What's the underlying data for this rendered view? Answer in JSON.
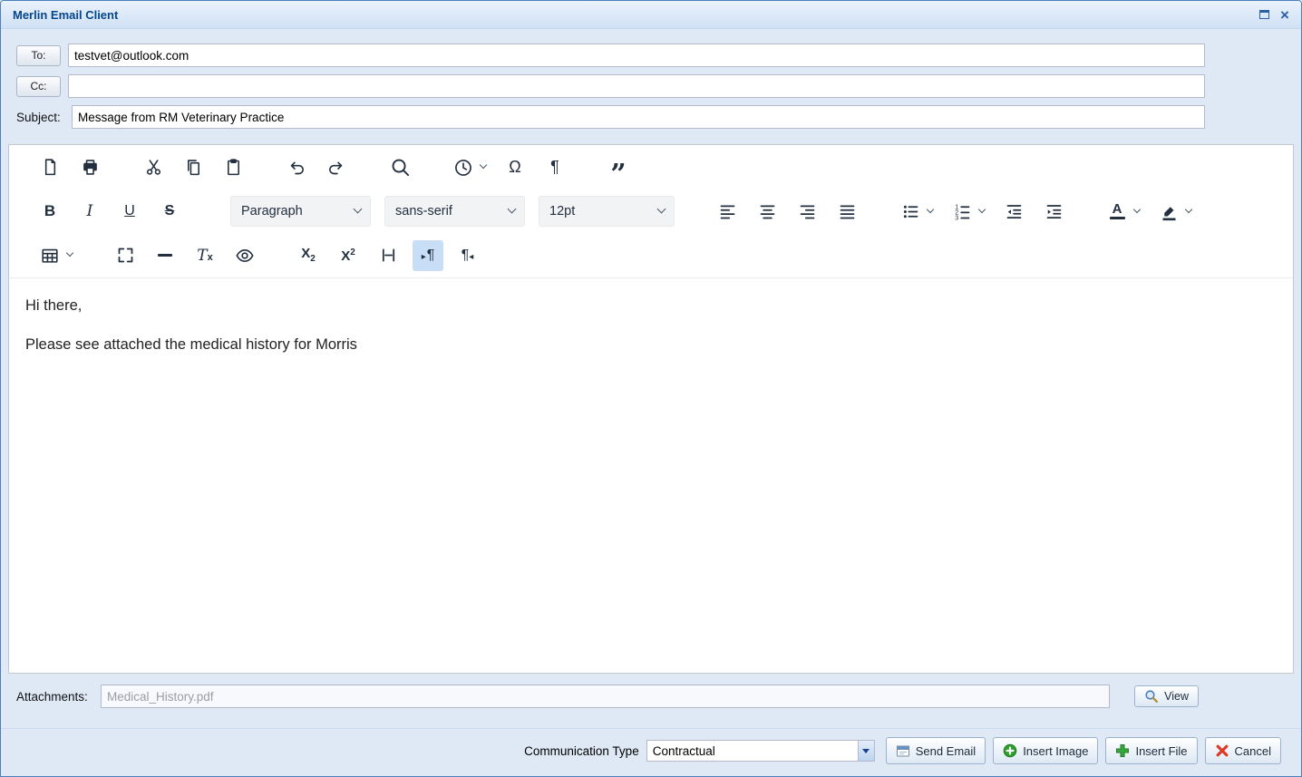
{
  "window": {
    "title": "Merlin Email Client",
    "close_glyph": "×"
  },
  "recipients": {
    "to_button": "To:",
    "to_value": "testvet@outlook.com",
    "cc_button": "Cc:",
    "cc_value": "",
    "subject_label": "Subject:",
    "subject_value": "Message from RM Veterinary Practice"
  },
  "editor": {
    "format_select": "Paragraph",
    "font_select": "sans-serif",
    "size_select": "12pt",
    "glyphs": {
      "bold": "B",
      "italic": "I",
      "underline": "U",
      "strikethrough": "S",
      "special_char": "Ω",
      "paragraph_mark": "¶",
      "blockquote": "”",
      "forecolor": "A",
      "clear_format_t": "T",
      "clear_format_x": "x",
      "script_base": "X",
      "subscript_small": "2",
      "superscript_small": "2",
      "ltr_arrow": "▸",
      "rtl_arrow": "◂",
      "pilcrow": "¶"
    },
    "body": [
      "Hi there,",
      "Please see attached the medical history for Morris"
    ]
  },
  "attachments": {
    "label": "Attachments:",
    "filename": "Medical_History.pdf",
    "view_button": "View"
  },
  "footer": {
    "communication_type_label": "Communication Type",
    "communication_type_value": "Contractual",
    "send_email_button": "Send Email",
    "insert_image_button": "Insert Image",
    "insert_file_button": "Insert File",
    "cancel_button": "Cancel"
  },
  "colors": {
    "title_text": "#04468c",
    "icon": "#222f3e",
    "active_toolbar_bg": "#c8def7",
    "window_bg": "#dfe9f6"
  }
}
